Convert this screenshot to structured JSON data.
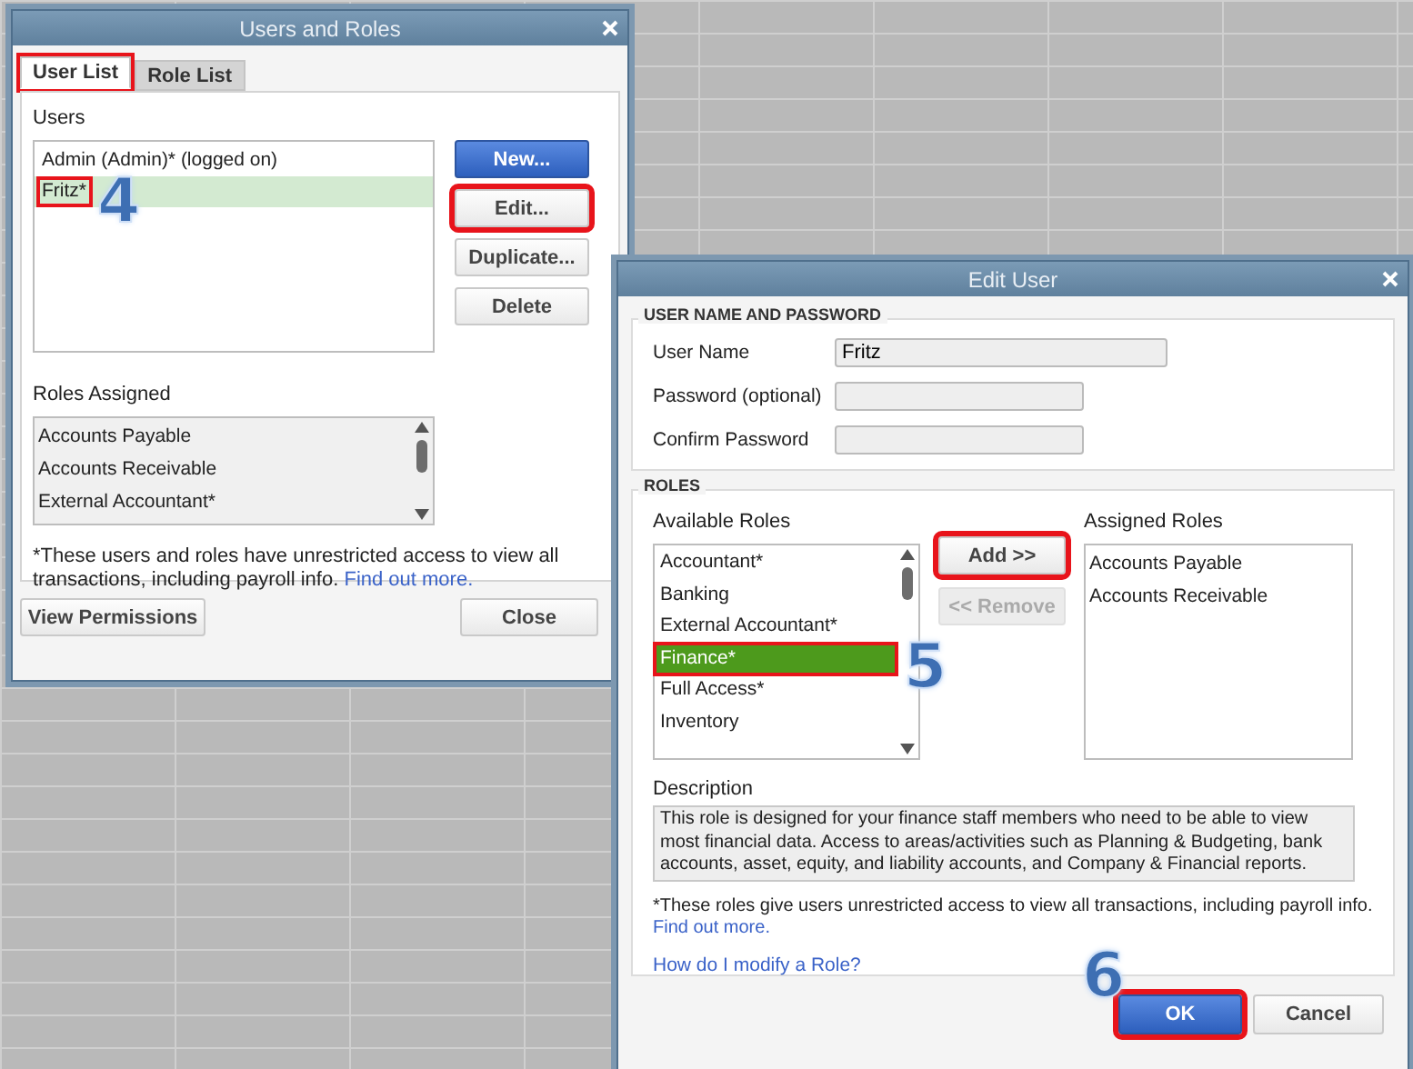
{
  "users_and_roles": {
    "title": "Users and Roles",
    "tabs": [
      {
        "label": "User List",
        "selected": true,
        "highlighted": true
      },
      {
        "label": "Role List",
        "selected": false,
        "highlighted": false
      }
    ],
    "users_label": "Users",
    "users": [
      {
        "name": "Admin (Admin)* (logged on)",
        "selected": false,
        "highlighted": false
      },
      {
        "name": "Fritz*",
        "selected": true,
        "highlighted": true,
        "callout": "4"
      }
    ],
    "buttons": [
      {
        "label": "New...",
        "kind": "primary",
        "highlighted": false
      },
      {
        "label": "Edit...",
        "kind": "normal",
        "highlighted": true
      },
      {
        "label": "Duplicate...",
        "kind": "normal",
        "highlighted": false
      },
      {
        "label": "Delete",
        "kind": "normal",
        "highlighted": false
      }
    ],
    "roles_assigned_label": "Roles Assigned",
    "roles_assigned": [
      "Accounts Payable",
      "Accounts Receivable",
      "External Accountant*"
    ],
    "footnote": "*These users and roles have unrestricted access to view all transactions, including payroll info.",
    "footnote_link": "Find out more.",
    "bottom_buttons": [
      "View Permissions",
      "Close"
    ]
  },
  "edit_user": {
    "title": "Edit User",
    "account_heading": "USER NAME AND PASSWORD",
    "fields": [
      {
        "label": "User Name",
        "value": "Fritz"
      },
      {
        "label": "Password (optional)"
      },
      {
        "label": "Confirm Password"
      }
    ],
    "roles_heading": "ROLES",
    "available_label": "Available Roles",
    "available": [
      {
        "name": "Accountant*",
        "selected": false,
        "highlighted": false
      },
      {
        "name": "Banking",
        "selected": false,
        "highlighted": false
      },
      {
        "name": "External Accountant*",
        "selected": false,
        "highlighted": false
      },
      {
        "name": "Finance*",
        "selected": true,
        "highlighted": true,
        "callout": "5"
      },
      {
        "name": "Full Access*",
        "selected": false,
        "highlighted": false
      },
      {
        "name": "Inventory",
        "selected": false,
        "highlighted": false
      }
    ],
    "move_buttons": [
      {
        "label": "Add >>",
        "disabled": false,
        "highlighted": true
      },
      {
        "label": "<< Remove",
        "disabled": true,
        "highlighted": false
      }
    ],
    "assigned_label": "Assigned Roles",
    "assigned": [
      "Accounts Payable",
      "Accounts Receivable"
    ],
    "description_label": "Description",
    "description": "This role is designed for your finance staff members who need to be able to view most financial data. Access to areas/activities such as Planning & Budgeting, bank accounts, asset, equity, and liability accounts, and Company & Financial reports.",
    "footnote": "*These roles give users unrestricted access to view all transactions, including payroll info.",
    "footnote_link": "Find out more.",
    "help_link": "How do I modify a Role?",
    "buttons": [
      {
        "label": "OK",
        "kind": "primary",
        "highlighted": true,
        "callout": "6"
      },
      {
        "label": "Cancel",
        "kind": "normal",
        "highlighted": false
      }
    ]
  }
}
